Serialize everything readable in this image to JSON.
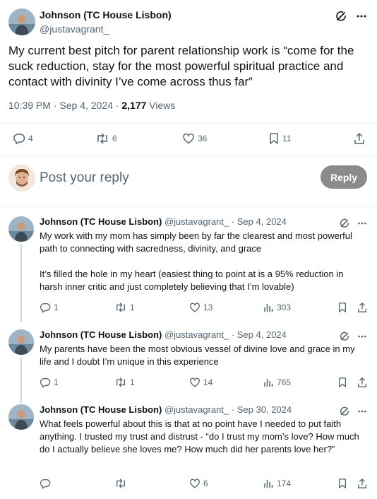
{
  "tweet": {
    "author_name": "Johnson (TC House Lisbon)",
    "author_handle": "@justavagrant_",
    "text": "My current best pitch for parent relationship work is “come for the suck reduction, stay for the most powerful spiritual practice and contact with divinity I’ve come across thus far”",
    "time": "10:39 PM",
    "date": "Sep 4, 2024",
    "views_count": "2,177",
    "views_label": "Views",
    "replies": "4",
    "reposts": "6",
    "likes": "36",
    "bookmarks": "11"
  },
  "reply_box": {
    "placeholder": "Post your reply",
    "button": "Reply"
  },
  "replies": [
    {
      "name": "Johnson (TC House Lisbon)",
      "handle": "@justavagrant_",
      "date": "Sep 4, 2024",
      "para1": "My work with my mom has simply been by far the clearest and most powerful path to connecting with sacredness, divinity, and grace",
      "para2": "It’s filled the hole in my heart (easiest thing to point at is a 95% reduction in harsh inner critic and just completely believing that I’m lovable)",
      "replies": "1",
      "reposts": "1",
      "likes": "13",
      "views": "303"
    },
    {
      "name": "Johnson (TC House Lisbon)",
      "handle": "@justavagrant_",
      "date": "Sep 4, 2024",
      "para1": "My parents have been the most obvious vessel of divine love and grace in my life and I doubt I’m unique in this experience",
      "replies": "1",
      "reposts": "1",
      "likes": "14",
      "views": "765"
    },
    {
      "name": "Johnson (TC House Lisbon)",
      "handle": "@justavagrant_",
      "date": "Sep 30, 2024",
      "para1": "What feels powerful about this is that at no point have I needed to put faith anything. I trusted my trust and distrust - “do I trust my mom’s love? How much do I actually believe she loves me? How much did her parents love her?”",
      "likes": "6",
      "views": "174"
    }
  ]
}
